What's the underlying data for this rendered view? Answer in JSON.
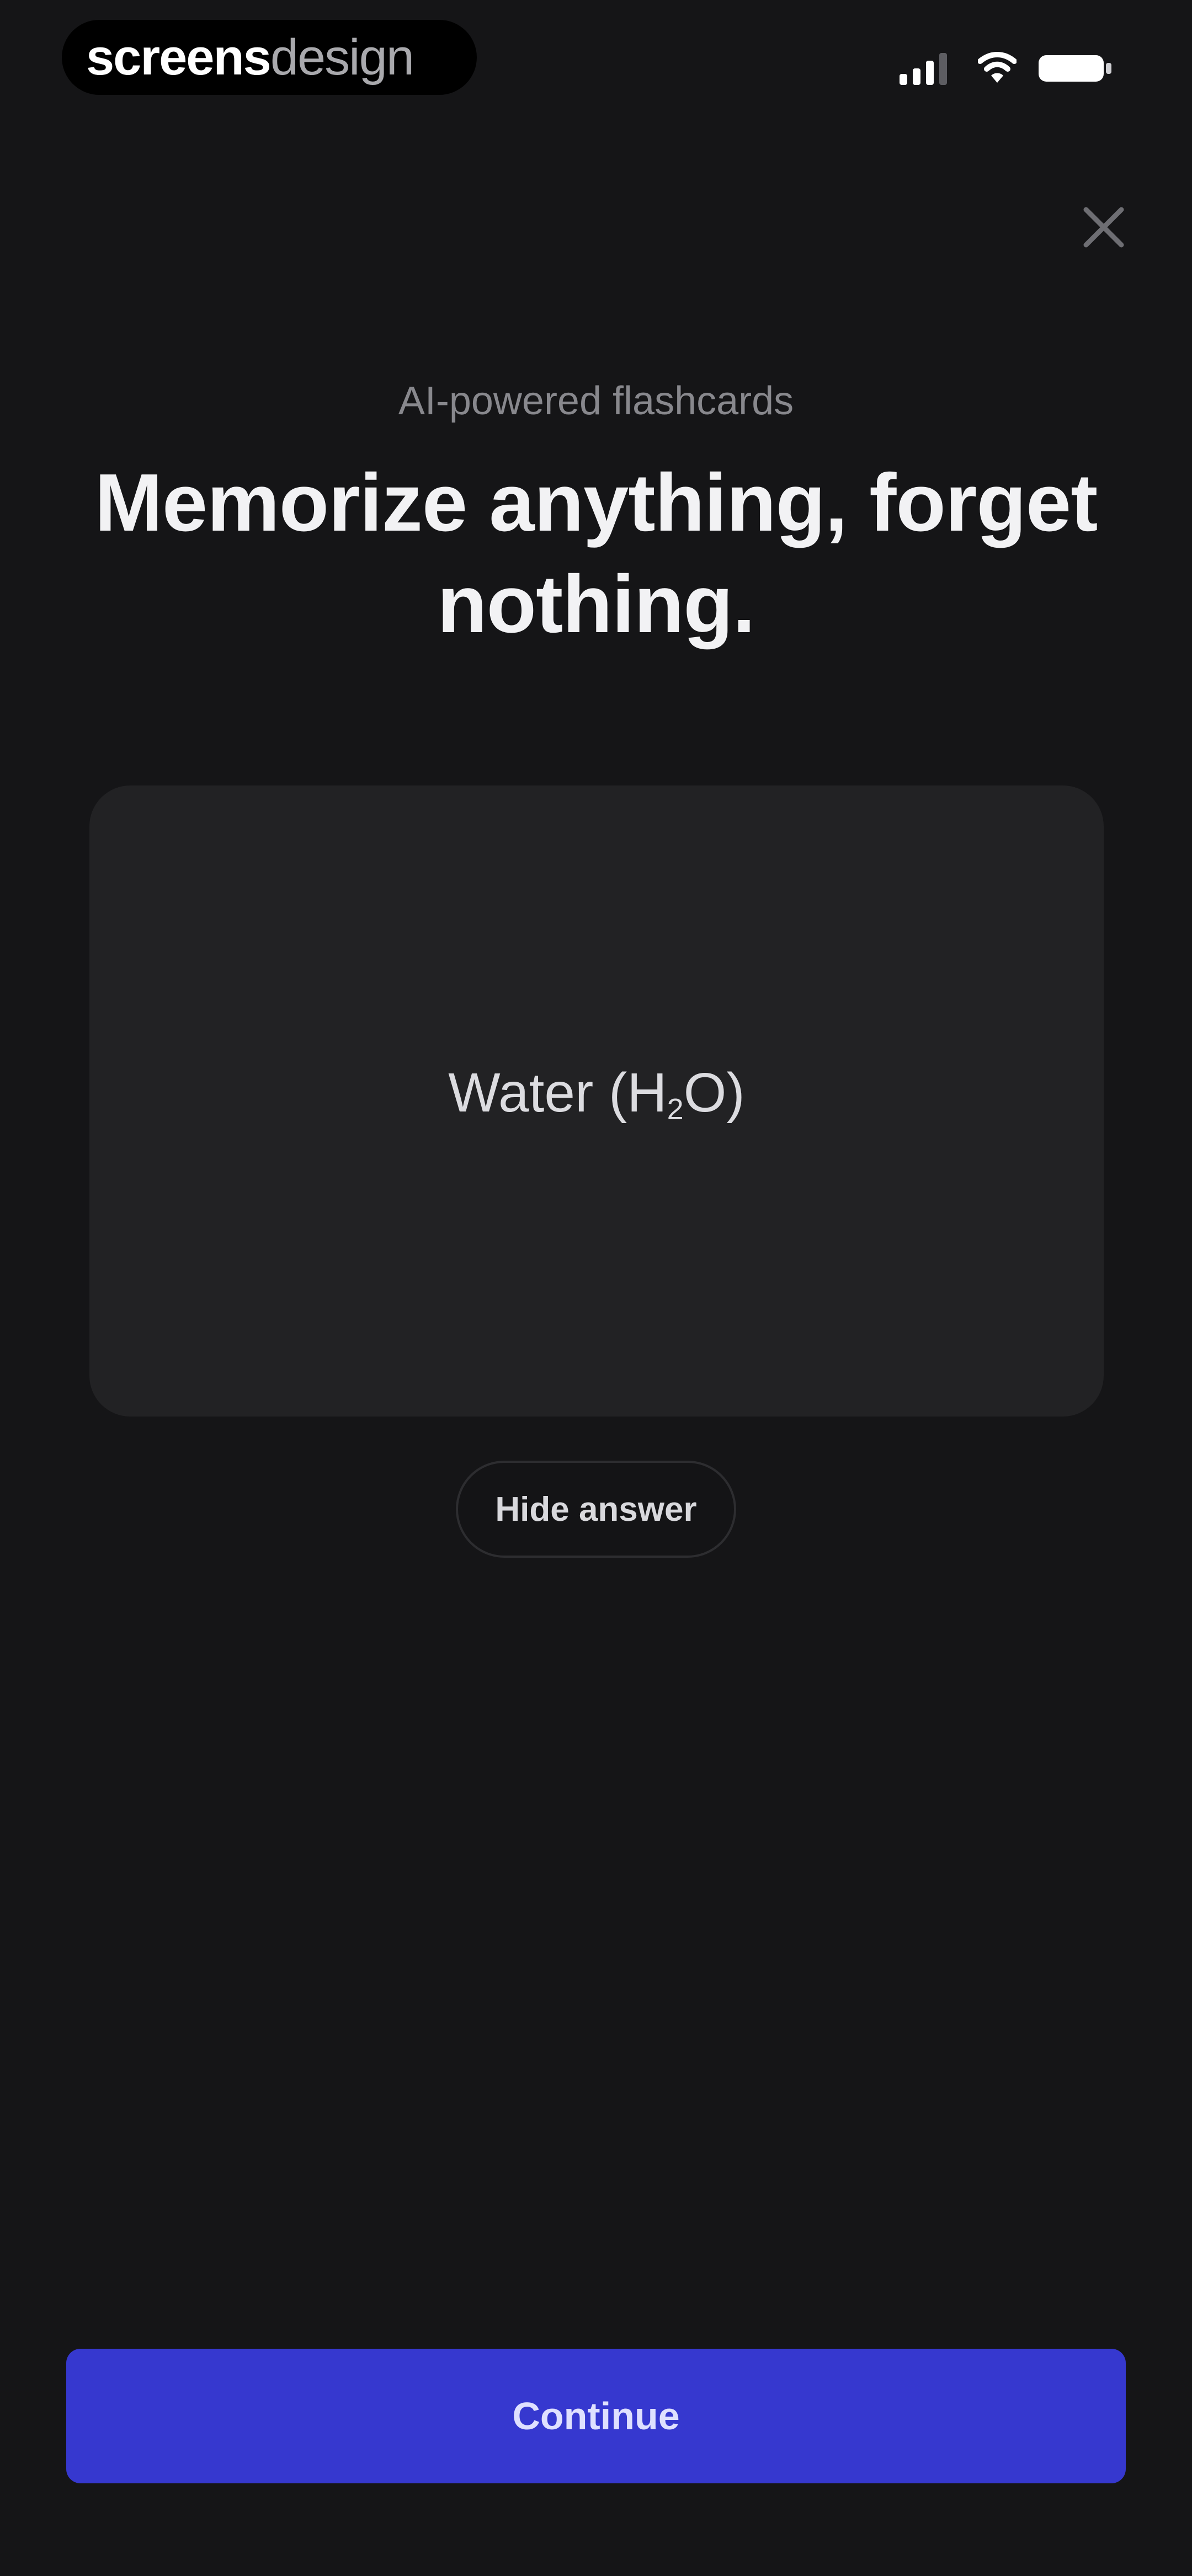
{
  "branding": {
    "logo_primary": "screens",
    "logo_secondary": "design"
  },
  "status_bar": {
    "icons": [
      "signal-icon",
      "wifi-icon",
      "battery-icon"
    ]
  },
  "header": {
    "close_icon": "close-icon"
  },
  "onboarding": {
    "eyebrow": "AI-powered flashcards",
    "headline": "Memorize anything, forget nothing."
  },
  "flashcard": {
    "answer_main": "Water (H",
    "answer_subscript": "2",
    "answer_tail": "O)"
  },
  "actions": {
    "hide_answer_label": "Hide answer",
    "continue_label": "Continue"
  },
  "colors": {
    "background": "#151517",
    "card": "#222224",
    "accent": "#3638CF"
  }
}
